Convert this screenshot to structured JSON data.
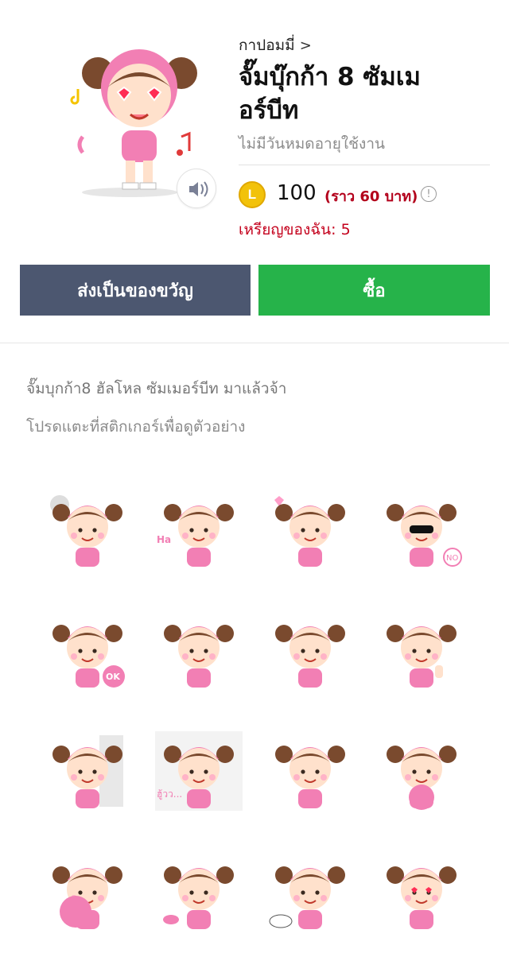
{
  "header": {
    "author": "กาปอมมี่",
    "author_chevron": ">",
    "title": "จั๊มบุ๊กก้า 8 ซัมเมอร์บีท",
    "expiry": "ไม่มีวันหมดอายุใช้งาน",
    "coin_letter": "L",
    "price": "100",
    "price_baht": "(ราว 60 บาท)",
    "info_glyph": "!",
    "my_coins": "เหรียญของฉัน: 5"
  },
  "buttons": {
    "gift_label": "ส่งเป็นของขวัญ",
    "buy_label": "ซื้อ"
  },
  "body": {
    "description": "จั๊มบุกก้า8 ฮัลโหล ซัมเมอร์บีท มาแล้วจ้า",
    "hint": "โปรดแตะที่สติกเกอร์เพื่อดูตัวอย่าง"
  },
  "sticker_texts": {
    "haha": "Ha",
    "no": "NO",
    "ok": "OK",
    "huu": "ฮู้วว..."
  },
  "colors": {
    "gift_button": "#4c5770",
    "buy_button": "#26b34a",
    "price_red": "#b3001b",
    "coin_gold": "#f2c20a",
    "sticker_pink": "#f27fb4",
    "hair_brown": "#7a4a2e"
  },
  "stickers": [
    {
      "icon": "sticker-girl-fan"
    },
    {
      "icon": "sticker-girl-laughing"
    },
    {
      "icon": "sticker-girl-hearts"
    },
    {
      "icon": "sticker-girl-sunglasses-no"
    },
    {
      "icon": "sticker-girl-ok"
    },
    {
      "icon": "sticker-girl-thank-you"
    },
    {
      "icon": "sticker-girl-wai"
    },
    {
      "icon": "sticker-girl-thumbs-up"
    },
    {
      "icon": "sticker-girl-peek"
    },
    {
      "icon": "sticker-girl-huu"
    },
    {
      "icon": "sticker-girl-thinking"
    },
    {
      "icon": "sticker-girl-plate"
    },
    {
      "icon": "sticker-girl-plate-face"
    },
    {
      "icon": "sticker-girl-back"
    },
    {
      "icon": "sticker-girl-sleepy"
    },
    {
      "icon": "sticker-girl-heart-eyes"
    }
  ]
}
